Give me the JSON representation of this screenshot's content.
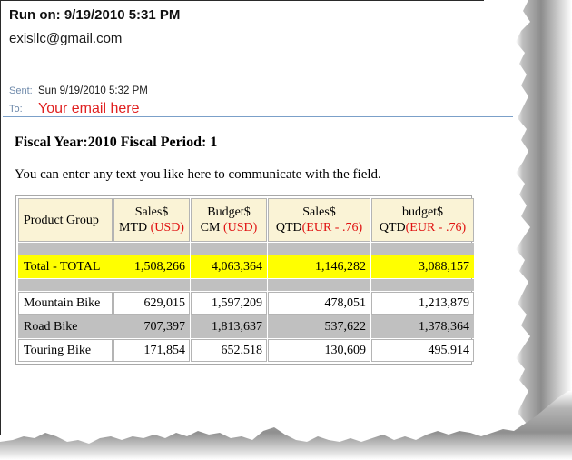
{
  "email": {
    "run_on_label": "Run on: 9/19/2010 5:31 PM",
    "from_address": "exisllc@gmail.com",
    "sent_label": "Sent:",
    "sent_value": "Sun 9/19/2010 5:32 PM",
    "to_label": "To:",
    "to_value": "Your email here"
  },
  "body": {
    "fiscal_line": "Fiscal Year:2010 Fiscal Period: 1",
    "free_text": "You can enter any text you like here to communicate with the field."
  },
  "report": {
    "headers": [
      {
        "line1": "",
        "line2": "Product Group",
        "currency": ""
      },
      {
        "line1": "Sales$",
        "line2": "MTD ",
        "currency": "(USD)"
      },
      {
        "line1": "Budget$",
        "line2": "CM ",
        "currency": "(USD)"
      },
      {
        "line1": "Sales$",
        "line2": "QTD",
        "currency": "(EUR - .76)"
      },
      {
        "line1": "budget$",
        "line2": "QTD",
        "currency": "(EUR - .76)"
      }
    ],
    "total_row": {
      "label": "Total - TOTAL",
      "values": [
        "1,508,266",
        "4,063,364",
        "1,146,282",
        "3,088,157"
      ]
    },
    "rows": [
      {
        "label": "Mountain Bike",
        "values": [
          "629,015",
          "1,597,209",
          "478,051",
          "1,213,879"
        ]
      },
      {
        "label": "Road Bike",
        "values": [
          "707,397",
          "1,813,637",
          "537,622",
          "1,378,364"
        ]
      },
      {
        "label": "Touring Bike",
        "values": [
          "171,854",
          "652,518",
          "130,609",
          "495,914"
        ]
      }
    ]
  },
  "colors": {
    "header_bg": "#faf3d6",
    "total_bg": "#ffff00",
    "alt_row_bg": "#c0c0c0",
    "spacer_bg": "#c0c0c0",
    "currency_text": "#e01010",
    "meta_label": "#6f8aab",
    "meta_rule": "#7ba0c9",
    "to_value": "#e02020"
  }
}
